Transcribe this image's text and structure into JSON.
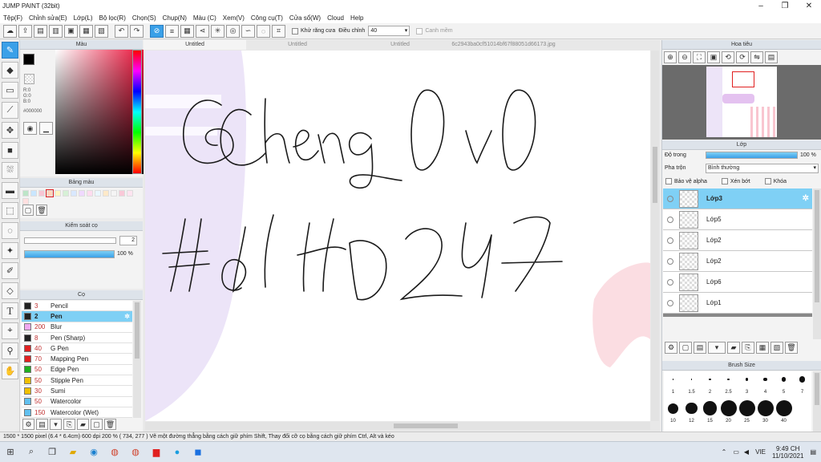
{
  "window": {
    "title": "JUMP PAINT (32bit)",
    "controls": [
      "–",
      "❐",
      "✕"
    ]
  },
  "menu": [
    "Tệp(F)",
    "Chỉnh sửa(E)",
    "Lớp(L)",
    "Bộ lọc(R)",
    "Chọn(S)",
    "Chụp(N)",
    "Màu (C)",
    "Xem(V)",
    "Công cụ(T)",
    "Cửa sổ(W)",
    "Cloud",
    "Help"
  ],
  "toolbar": {
    "antialias_label": "Khử răng cưa",
    "correction_label": "Điều chỉnh",
    "correction_value": "40",
    "canh_mem_label": "Canh mềm"
  },
  "color_panel": {
    "title": "Màu",
    "hsv": [
      "R:0",
      "G:0",
      "B:0"
    ],
    "hex": "#000000",
    "current": "#000000"
  },
  "swatch_panel": {
    "title": "Bảng màu",
    "colors": [
      "#bde5c8",
      "#c9e6ff",
      "#f7c6d4",
      "#ffd4b8",
      "#fff5c2",
      "#d6f0d6",
      "#d9e8ff",
      "#efd9ff",
      "#ffdcef",
      "#e9f7ff",
      "#ffe9c9",
      "#f4f4f4",
      "#f9c9d8",
      "#ffe4f0",
      "#ffe0e0"
    ]
  },
  "slider_panel": {
    "title": "Kiểm soát cọ",
    "size_value": "2",
    "opacity_value": "100 %",
    "opacity_fraction": 1.0
  },
  "brush_panel": {
    "title": "Cọ",
    "items": [
      {
        "size": "3",
        "name": "Pencil",
        "color": "#222222",
        "selected": false
      },
      {
        "size": "2",
        "name": "Pen",
        "color": "#222222",
        "selected": true
      },
      {
        "size": "200",
        "name": "Blur",
        "color": "#f0a8f0",
        "selected": false
      },
      {
        "size": "8",
        "name": "Pen (Sharp)",
        "color": "#222222",
        "selected": false
      },
      {
        "size": "40",
        "name": "G Pen",
        "color": "#e02020",
        "selected": false
      },
      {
        "size": "70",
        "name": "Mapping Pen",
        "color": "#e02020",
        "selected": false
      },
      {
        "size": "50",
        "name": "Edge Pen",
        "color": "#20b020",
        "selected": false
      },
      {
        "size": "50",
        "name": "Stipple Pen",
        "color": "#f0c000",
        "selected": false
      },
      {
        "size": "30",
        "name": "Sumi",
        "color": "#f0c000",
        "selected": false
      },
      {
        "size": "50",
        "name": "Watercolor",
        "color": "#60c0f0",
        "selected": false
      },
      {
        "size": "150",
        "name": "Watercolor (Wet)",
        "color": "#60c0f0",
        "selected": false
      }
    ]
  },
  "tabs": [
    "Untitled",
    "Untitled",
    "Untitled",
    "6c2943ba0cf51014bf67f88051d66173.jpg"
  ],
  "handwriting": {
    "line1": "@Cheng 0 v 0",
    "line2": "#HHD247"
  },
  "navigator": {
    "title": "Hoa tiêu"
  },
  "layers_panel": {
    "title": "Lớp",
    "opacity_label": "Độ trong",
    "opacity_value": "100 %",
    "blend_label": "Pha trộn",
    "blend_value": "Bình thường",
    "protect_alpha": "Bảo vệ alpha",
    "clip_label": "Xén bớt",
    "lock_label": "Khóa",
    "layers": [
      {
        "name": "Lớp3",
        "selected": true
      },
      {
        "name": "Lớp5",
        "selected": false
      },
      {
        "name": "Lớp2",
        "selected": false
      },
      {
        "name": "Lớp2",
        "selected": false
      },
      {
        "name": "Lớp6",
        "selected": false
      },
      {
        "name": "Lớp1",
        "selected": false
      }
    ]
  },
  "brush_size_panel": {
    "title": "Brush Size",
    "rows": [
      [
        "1",
        "1.5",
        "2",
        "2.5",
        "3",
        "4",
        "5",
        "7"
      ],
      [
        "10",
        "12",
        "15",
        "20",
        "25",
        "30",
        "40",
        ""
      ]
    ]
  },
  "status": "1500 * 1500 pixel   (6.4 * 6.4cm)   600 dpi   200 %   ( 734, 277 )   Vẽ một đường thẳng bằng cách giữ phím Shift, Thay đổi cỡ cọ bằng cách giữ phím Ctrl, Alt và kéo",
  "taskbar": {
    "time": "9:49 CH",
    "date": "11/10/2021",
    "lang": "VIE"
  }
}
